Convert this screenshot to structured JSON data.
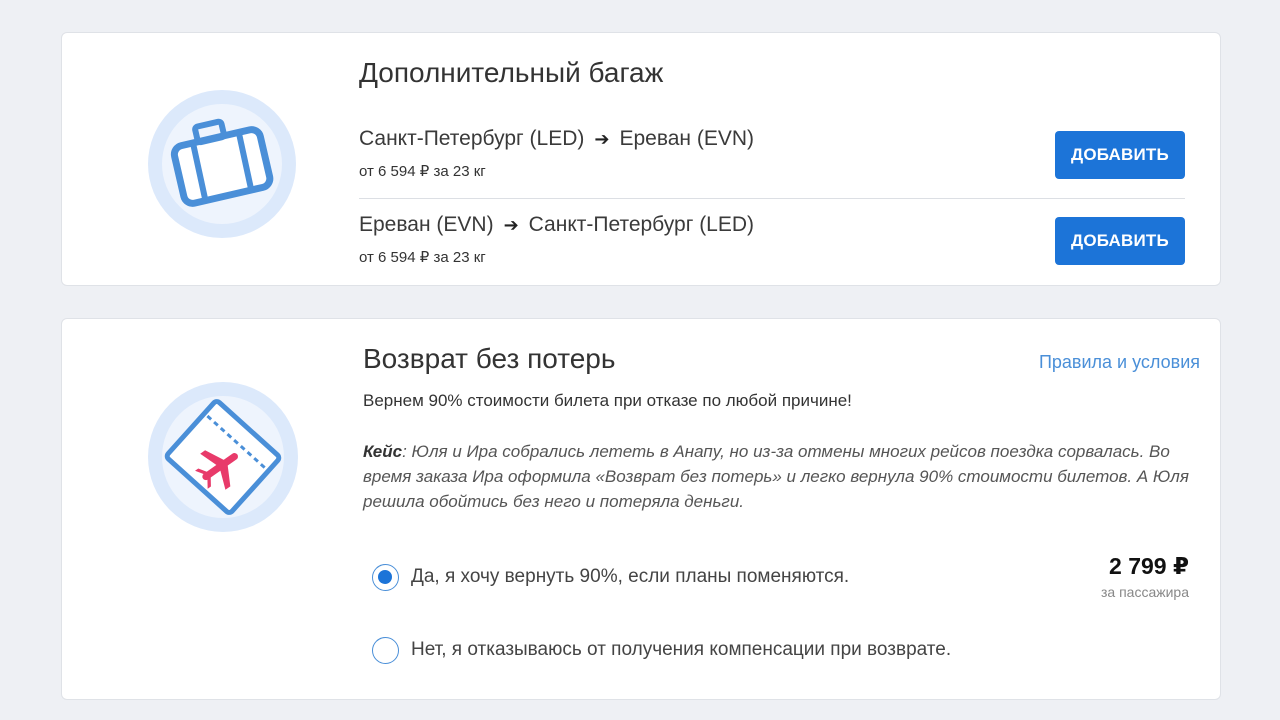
{
  "baggage": {
    "title": "Дополнительный багаж",
    "icon": "suitcase-icon",
    "routes": [
      {
        "from": "Санкт-Петербург (LED)",
        "arrow": "➔",
        "to": "Ереван (EVN)",
        "price": "от 6 594 ₽ за 23 кг",
        "button": "ДОБАВИТЬ"
      },
      {
        "from": "Ереван (EVN)",
        "arrow": "➔",
        "to": "Санкт-Петербург (LED)",
        "price": "от 6 594 ₽ за 23 кг",
        "button": "ДОБАВИТЬ"
      }
    ]
  },
  "refund": {
    "title": "Возврат без потерь",
    "icon": "ticket-plane-icon",
    "rules_link": "Правила и условия",
    "lead": "Вернем 90% стоимости билета при отказе по любой причине!",
    "case_label": "Кейс",
    "case_text": ": Юля и Ира собрались лететь в Анапу, но из-за отмены многих рейсов поездка сорвалась. Во время заказа Ира оформила «Возврат без потерь» и легко вернула 90% стоимости билетов. А Юля решила обойтись без него и потеряла деньги.",
    "options": [
      {
        "label": "Да, я хочу вернуть 90%, если планы поменяются.",
        "selected": true
      },
      {
        "label": "Нет, я отказываюсь от получения компенсации при возврате.",
        "selected": false
      }
    ],
    "price": "2 799 ₽",
    "price_note": "за пассажира"
  },
  "colors": {
    "accent": "#1c74d8",
    "link": "#4a8fd8",
    "icon_circle": "#dce9fb",
    "icon_stroke": "#4a8fd8",
    "plane": "#e83a6a",
    "background": "#eef0f4"
  }
}
